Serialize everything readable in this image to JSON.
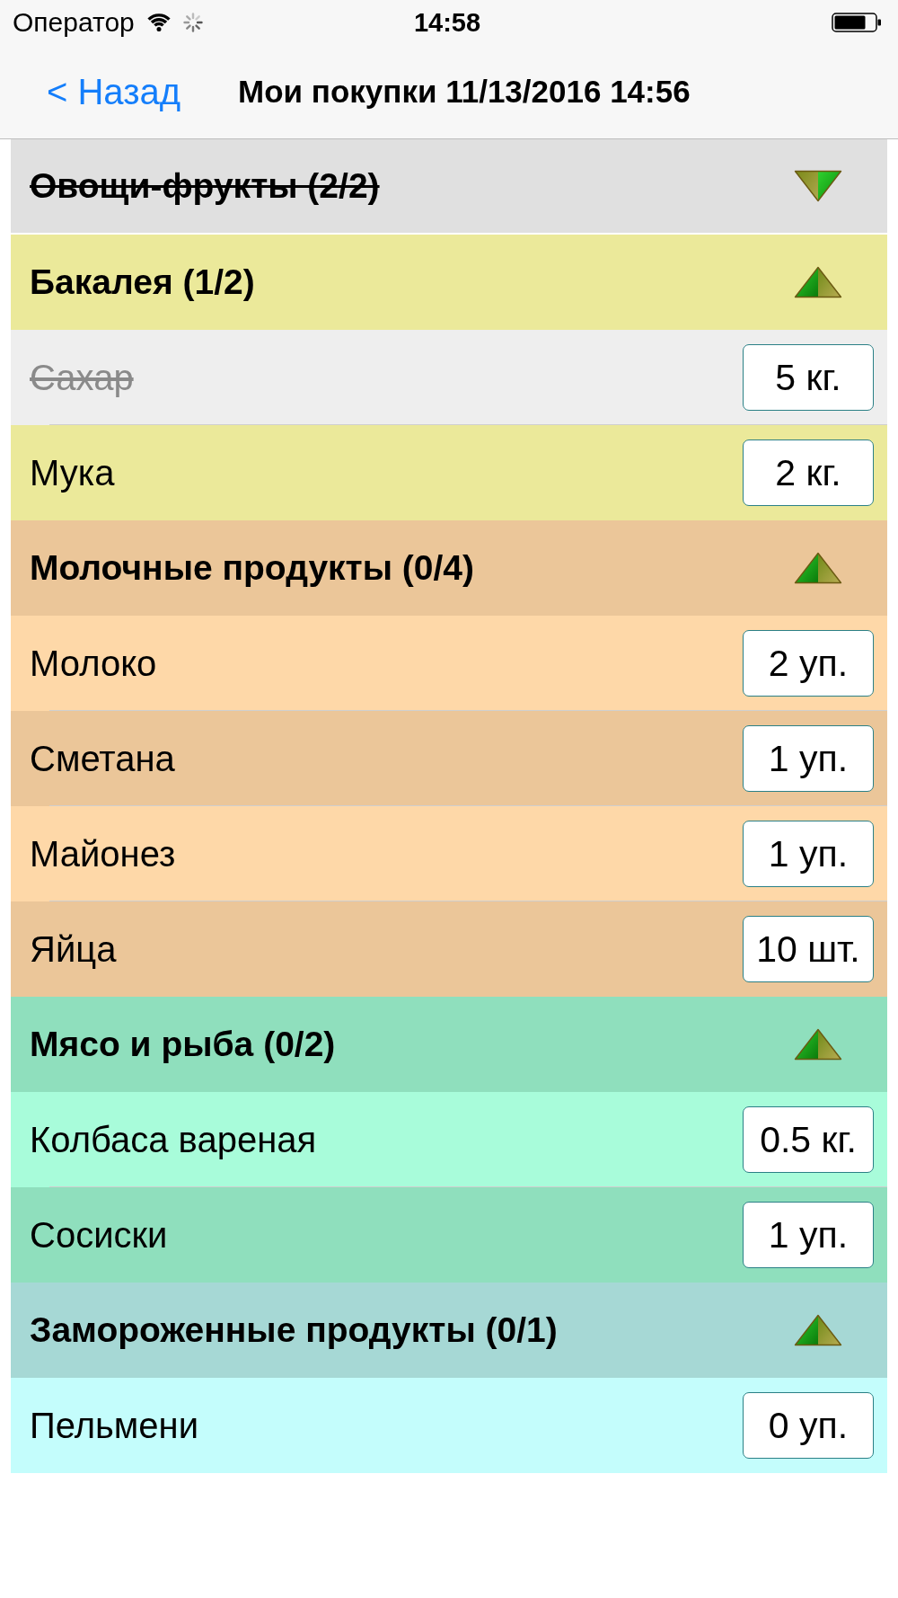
{
  "status_bar": {
    "carrier": "Оператор",
    "time": "14:58"
  },
  "nav_bar": {
    "back": "< Назад",
    "title": "Мои покупки 11/13/2016 14:56"
  },
  "groups": [
    {
      "title": "Овощи-фрукты (2/2)",
      "done": true,
      "expanded": false,
      "color": "#e0e0e0"
    },
    {
      "title": "Бакалея (1/2)",
      "done": false,
      "expanded": true,
      "color": "#ebe99a",
      "items": [
        {
          "name": "Сахар",
          "quantity": "5 кг.",
          "done": true,
          "color": "#eeeeee"
        },
        {
          "name": "Мука",
          "quantity": "2 кг.",
          "done": false,
          "color": "#ebe99a"
        }
      ]
    },
    {
      "title": "Молочные продукты (0/4)",
      "done": false,
      "expanded": true,
      "color": "#ebc699",
      "items": [
        {
          "name": "Молоко",
          "quantity": "2 уп.",
          "done": false,
          "color": "#fed8a8"
        },
        {
          "name": "Сметана",
          "quantity": "1 уп.",
          "done": false,
          "color": "#ebc699"
        },
        {
          "name": "Майонез",
          "quantity": "1 уп.",
          "done": false,
          "color": "#fed8a8"
        },
        {
          "name": "Яйца",
          "quantity": "10 шт.",
          "done": false,
          "color": "#ebc699"
        }
      ]
    },
    {
      "title": "Мясо и рыба (0/2)",
      "done": false,
      "expanded": true,
      "color": "#8fdfbd",
      "items": [
        {
          "name": "Колбаса вареная",
          "quantity": "0.5 кг.",
          "done": false,
          "color": "#a8fcda"
        },
        {
          "name": "Сосиски",
          "quantity": "1 уп.",
          "done": false,
          "color": "#8fdfbd"
        }
      ]
    },
    {
      "title": "Замороженные продукты (0/1)",
      "done": false,
      "expanded": true,
      "color": "#a6d8d5",
      "items": [
        {
          "name": "Пельмени",
          "quantity": "0 уп.",
          "done": false,
          "color": "#c4fdfc"
        }
      ]
    }
  ]
}
